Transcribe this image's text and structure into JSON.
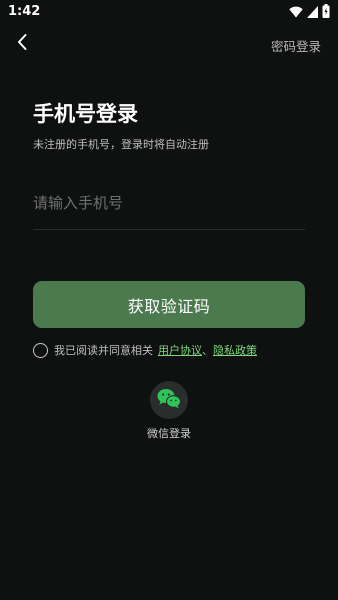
{
  "status_bar": {
    "time": "1:42"
  },
  "nav": {
    "back_icon": "chevron-left-icon",
    "password_login_label": "密码登录"
  },
  "login": {
    "title": "手机号登录",
    "subtitle": "未注册的手机号，登录时将自动注册",
    "phone_placeholder": "请输入手机号",
    "phone_value": "",
    "get_code_label": "获取验证码"
  },
  "agreement": {
    "checked": false,
    "prefix_text": "我已阅读并同意相关",
    "user_agreement_link": "用户协议",
    "separator": "、",
    "privacy_policy_link": "隐私政策"
  },
  "third_party": {
    "wechat_icon": "wechat-icon",
    "wechat_label": "微信登录"
  },
  "colors": {
    "background": "#0f1010",
    "button_bg": "#4b7a4f",
    "link": "#7ed87a",
    "wechat_green": "#2fc45a"
  }
}
